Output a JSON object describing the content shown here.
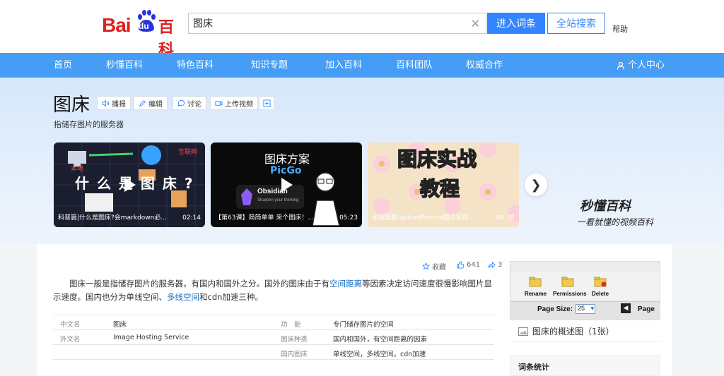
{
  "header": {
    "logo_text": "Bai",
    "logo_du": "du",
    "logo_baike": "百科",
    "search_value": "图床",
    "enter_button": "进入词条",
    "search_all_button": "全站搜索",
    "help_link": "帮助"
  },
  "nav": {
    "items": [
      "首页",
      "秒懂百科",
      "特色百科",
      "知识专题",
      "加入百科",
      "百科团队",
      "权威合作"
    ],
    "user_center": "个人中心"
  },
  "lemma": {
    "title": "图床",
    "subtitle": "指储存图片的服务器",
    "tools": {
      "broadcast": "播报",
      "edit": "编辑",
      "discuss": "讨论",
      "upload_video": "上传视频"
    }
  },
  "videos": [
    {
      "caption": "科普篇|什么是图床?会markdown必...",
      "duration": "02:14",
      "overlay": "什 么 是 图 床 ?"
    },
    {
      "caption": "【第63课】简简单单 来个图床！...",
      "duration": "05:23",
      "overlay_title": "图床方案",
      "overlay_sub": "PicGo",
      "overlay_badge": "Obsidian",
      "overlay_badge_sub": "Sharpen your thinking"
    },
    {
      "caption": "安装配置 uploadPicture插件实现...",
      "duration": "00:38",
      "overlay": "图床实战",
      "overlay2": "教程"
    }
  ],
  "miaodong": {
    "brand": "秒懂百科",
    "slogan": "一看就懂的视频百科"
  },
  "actions": {
    "favorite": "收藏",
    "likes": "641",
    "shares": "3"
  },
  "intro": {
    "p1_a": "图床一般是指储存图片的服务器，有国内和国外之分。国外的图床由于有",
    "p1_link1": "空间距离",
    "p1_b": "等因素决定访问速度很慢影响图片显示速度。国内也分为单线空间、",
    "p1_link2": "多线空间",
    "p1_c": "和cdn加速三种。"
  },
  "infobox": {
    "rows": [
      {
        "l1": "中文名",
        "v1": "图床",
        "l2": "功　能",
        "v2": "专门储存图片的空间"
      },
      {
        "l1": "外文名",
        "v1": "Image Hosting Service",
        "l2": "图床种类",
        "v2": "国内和国外，有空间距离的因素"
      },
      {
        "l1": "",
        "v1": "",
        "l2": "国内图床",
        "v2": "单线空间，多线空间，cdn加速"
      }
    ]
  },
  "album": {
    "toolbar": [
      "Rename",
      "Permissions",
      "Delete"
    ],
    "page_size_label": "Page Size:",
    "page_size_value": "25",
    "page_label": "Page",
    "caption": "图床的概述图（1张）"
  },
  "stats": {
    "title": "词条统计"
  },
  "colors": {
    "nav_bg": "#459df5",
    "accent": "#3385ff",
    "link": "#136ec2",
    "logo_red": "#de1f1f"
  }
}
